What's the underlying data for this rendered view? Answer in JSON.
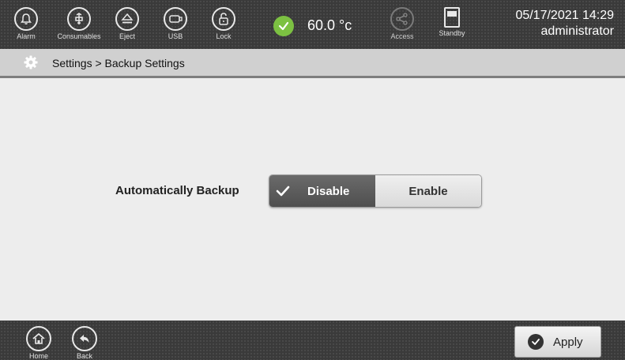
{
  "topbar": {
    "buttons": [
      {
        "label": "Alarm",
        "icon": "bell-icon"
      },
      {
        "label": "Consumables",
        "icon": "consumables-icon"
      },
      {
        "label": "Eject",
        "icon": "eject-icon"
      },
      {
        "label": "USB",
        "icon": "usb-icon"
      },
      {
        "label": "Lock",
        "icon": "unlock-icon"
      }
    ],
    "temperature": "60.0 °c",
    "temperature_status_color": "#7cc142",
    "access": {
      "label": "Access",
      "icon": "share-icon"
    },
    "standby": {
      "label": "Standby",
      "icon": "standby-icon"
    },
    "datetime": "05/17/2021 14:29",
    "user": "administrator"
  },
  "breadcrumb": {
    "icon": "gear-icon",
    "text": "Settings > Backup Settings"
  },
  "main": {
    "setting_label": "Automatically Backup",
    "toggle": {
      "options": [
        "Disable",
        "Enable"
      ],
      "selected": "Disable"
    }
  },
  "bottombar": {
    "home_label": "Home",
    "back_label": "Back",
    "apply_label": "Apply"
  }
}
